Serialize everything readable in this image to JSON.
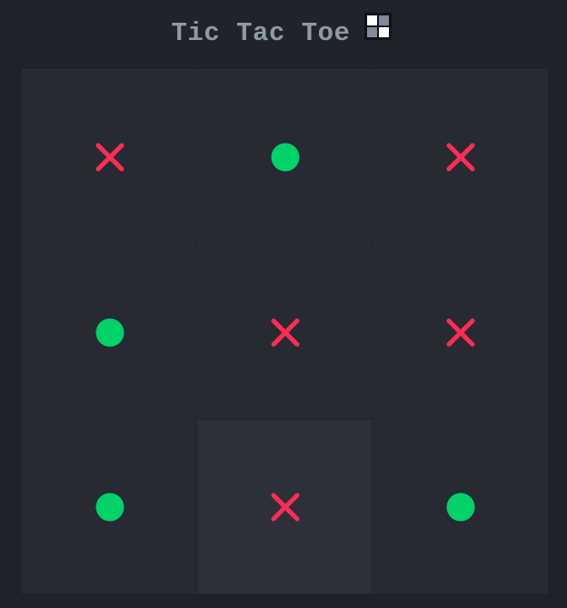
{
  "header": {
    "title": "Tic Tac Toe",
    "icon": "grid-icon"
  },
  "board": {
    "cells": [
      {
        "row": 1,
        "col": 1,
        "mark": "X",
        "highlighted": false
      },
      {
        "row": 1,
        "col": 2,
        "mark": "O",
        "highlighted": false
      },
      {
        "row": 1,
        "col": 3,
        "mark": "X",
        "highlighted": false
      },
      {
        "row": 2,
        "col": 1,
        "mark": "O",
        "highlighted": false
      },
      {
        "row": 2,
        "col": 2,
        "mark": "X",
        "highlighted": false
      },
      {
        "row": 2,
        "col": 3,
        "mark": "X",
        "highlighted": false
      },
      {
        "row": 3,
        "col": 1,
        "mark": "O",
        "highlighted": false
      },
      {
        "row": 3,
        "col": 2,
        "mark": "X",
        "highlighted": true
      },
      {
        "row": 3,
        "col": 3,
        "mark": "O",
        "highlighted": false
      }
    ]
  },
  "colors": {
    "x": "#ff2d55",
    "o": "#00d26a",
    "title": "#8e9aa5",
    "background": "#1f2229",
    "cell": "#272a32",
    "cell_highlight": "#2d3039"
  }
}
